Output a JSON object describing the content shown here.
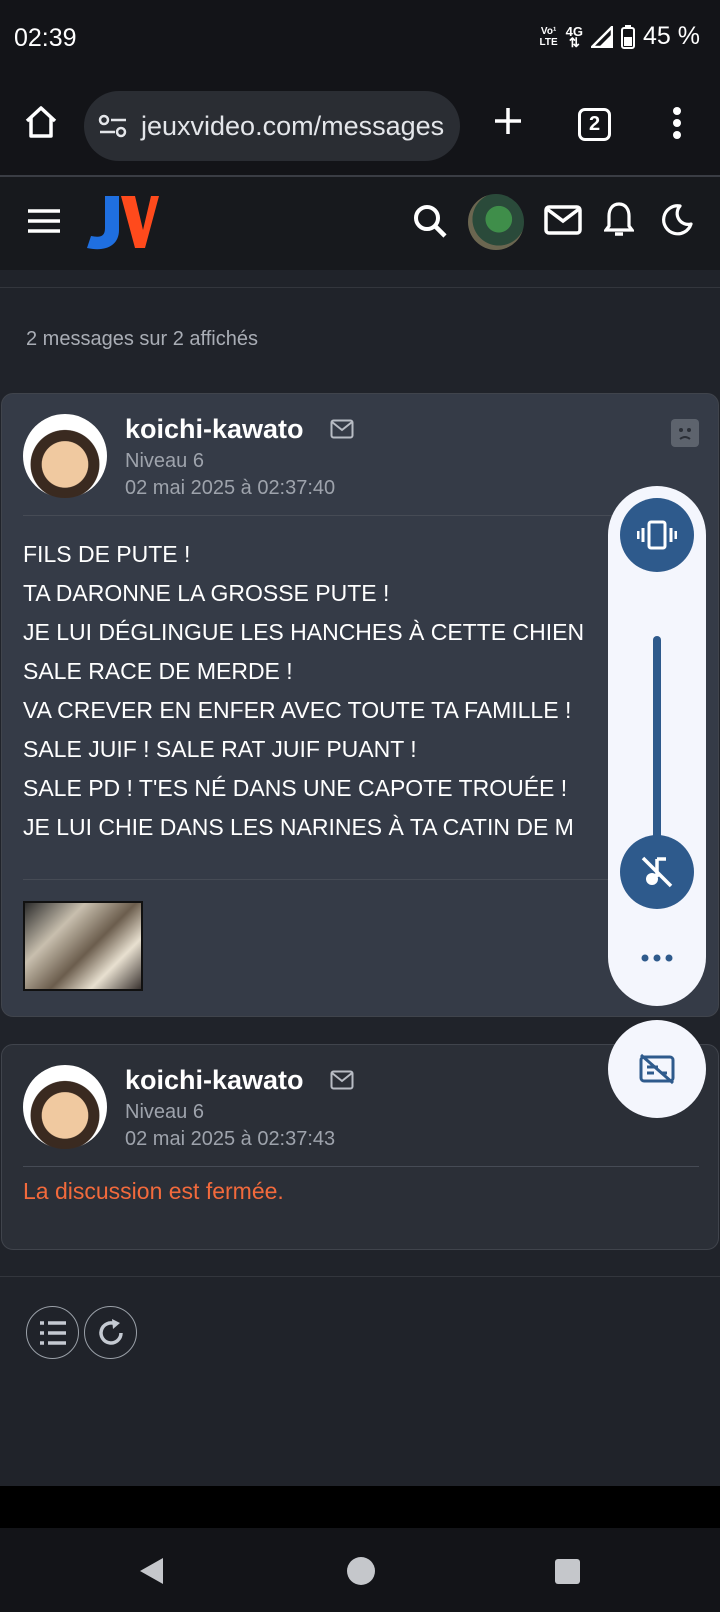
{
  "status": {
    "time": "02:39",
    "net_top": "Vo¹",
    "net_bottom": "LTE",
    "net_type": "4G",
    "battery": "45 %"
  },
  "browser": {
    "url": "jeuxvideo.com/messages",
    "tab_count": "2"
  },
  "jv": {
    "logo": "JV"
  },
  "page": {
    "count_text": "2 messages sur 2 affichés"
  },
  "messages": [
    {
      "author": "koichi-kawato",
      "level": "Niveau 6",
      "date": "02 mai 2025 à 02:37:40",
      "lines": [
        "FILS DE PUTE !",
        "TA DARONNE LA GROSSE PUTE !",
        "JE LUI DÉGLINGUE LES HANCHES À CETTE CHIEN",
        "SALE RACE DE MERDE !",
        "VA CREVER EN ENFER AVEC TOUTE TA FAMILLE !",
        "SALE JUIF ! SALE RAT JUIF PUANT !",
        "SALE PD ! T'ES NÉ DANS UNE CAPOTE TROUÉE !",
        "JE LUI CHIE DANS LES NARINES À TA CATIN DE M"
      ]
    },
    {
      "author": "koichi-kawato",
      "level": "Niveau 6",
      "date": "02 mai 2025 à 02:37:43",
      "closed": "La discussion est fermée."
    }
  ],
  "colors": {
    "accent_orange": "#f26a3c",
    "volume_blue": "#2e5a8c"
  }
}
